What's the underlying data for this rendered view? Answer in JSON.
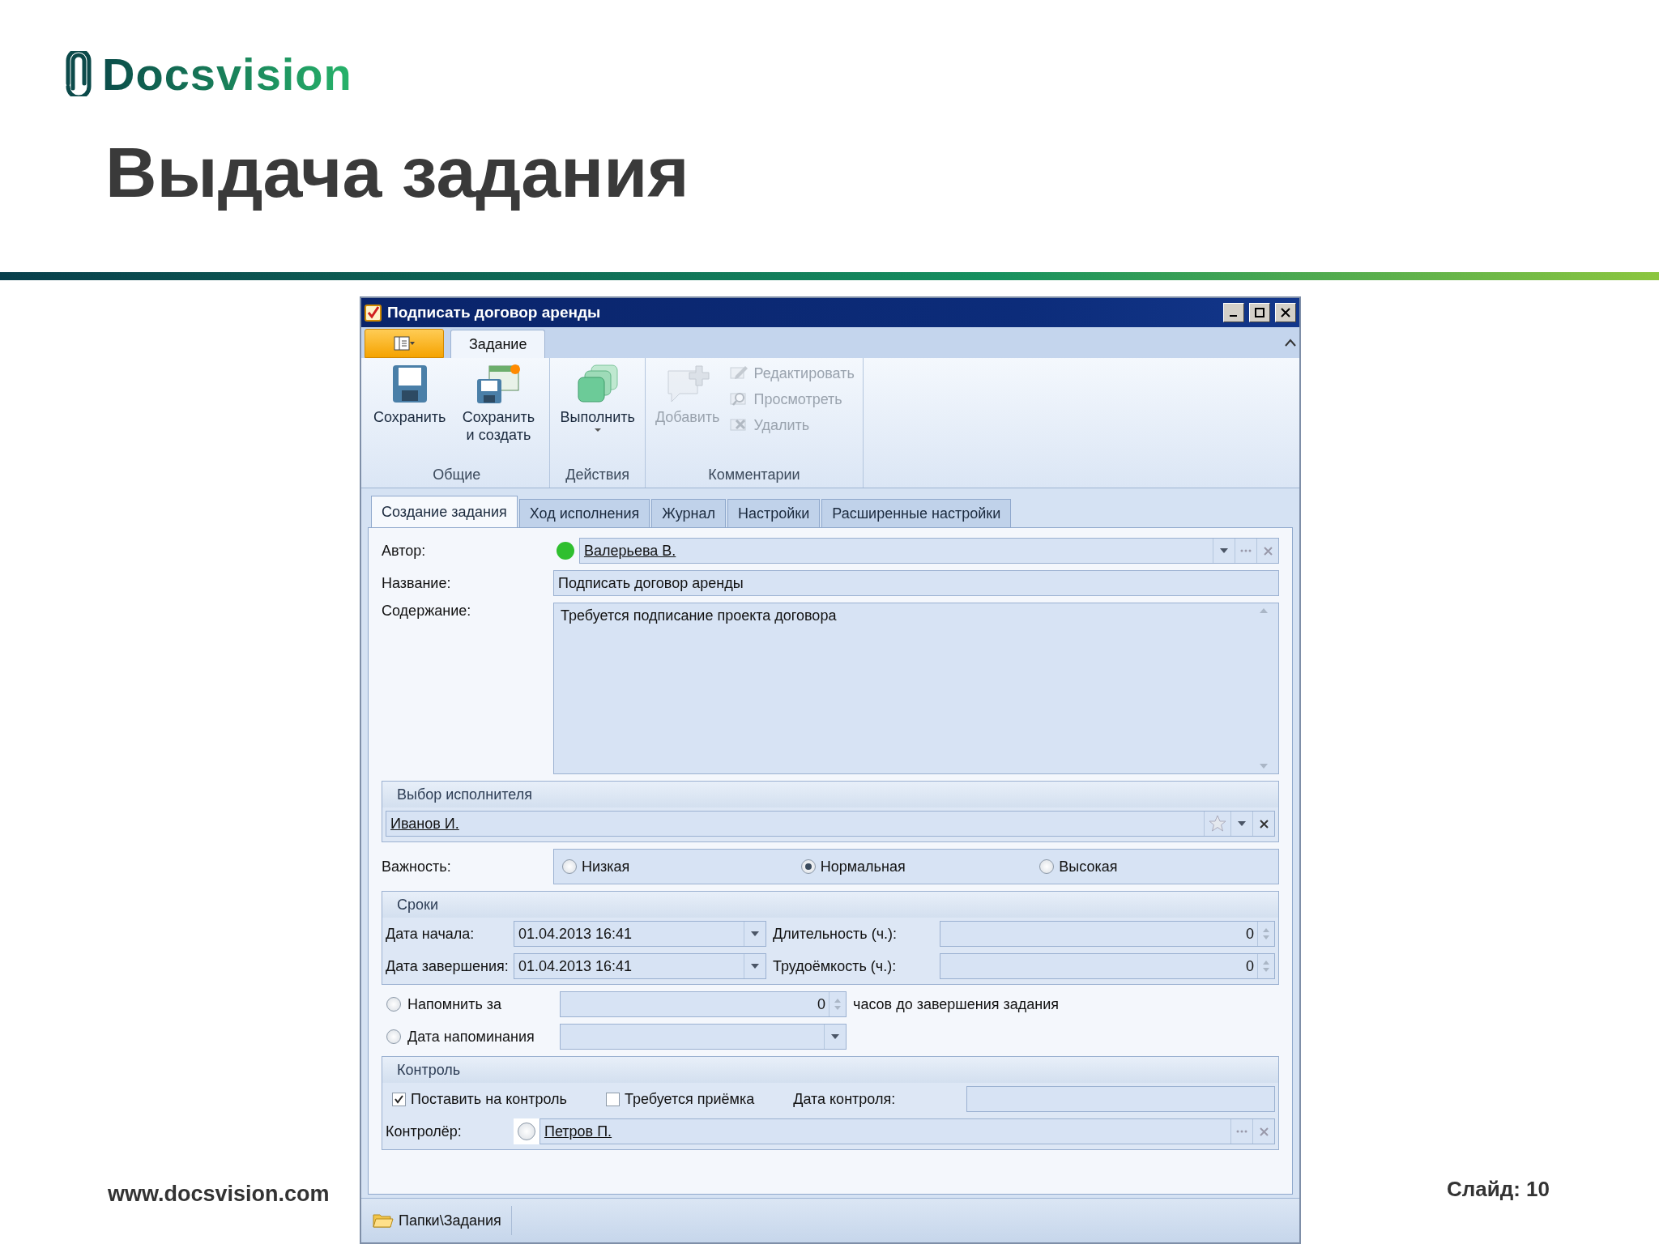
{
  "brand": {
    "logo_text": "Docsvision"
  },
  "slide_title": "Выдача задания",
  "window": {
    "title": "Подписать договор аренды",
    "ribbon": {
      "tabs": [
        {
          "label": "Задание",
          "selected": true
        }
      ],
      "groups": [
        {
          "label": "Общие",
          "buttons": [
            {
              "label": "Сохранить",
              "kind": "save",
              "disabled": false,
              "dropdown": false
            },
            {
              "label": "Сохранить и создать",
              "kind": "save-new",
              "disabled": false,
              "dropdown": false
            }
          ]
        },
        {
          "label": "Действия",
          "buttons": [
            {
              "label": "Выполнить",
              "kind": "run",
              "disabled": false,
              "dropdown": true
            }
          ]
        },
        {
          "label": "Комментарии",
          "buttons": [
            {
              "label": "Добавить",
              "kind": "add",
              "disabled": true,
              "dropdown": false
            }
          ],
          "small_buttons": [
            {
              "label": "Редактировать",
              "kind": "edit",
              "disabled": true
            },
            {
              "label": "Просмотреть",
              "kind": "view",
              "disabled": true
            },
            {
              "label": "Удалить",
              "kind": "delete",
              "disabled": true
            }
          ]
        }
      ]
    },
    "tabs": [
      {
        "label": "Создание задания",
        "selected": true
      },
      {
        "label": "Ход исполнения",
        "selected": false
      },
      {
        "label": "Журнал",
        "selected": false
      },
      {
        "label": "Настройки",
        "selected": false
      },
      {
        "label": "Расширенные настройки",
        "selected": false
      }
    ],
    "form": {
      "author": {
        "label": "Автор:",
        "value": "Валерьева В.",
        "color": "#2fbf2f"
      },
      "name": {
        "label": "Название:",
        "value": "Подписать договор аренды"
      },
      "content": {
        "label": "Содержание:",
        "value": "Требуется подписание проекта договора"
      },
      "performer": {
        "title": "Выбор исполнителя",
        "value": "Иванов И."
      },
      "importance": {
        "label": "Важность:",
        "options": [
          {
            "label": "Низкая",
            "selected": false
          },
          {
            "label": "Нормальная",
            "selected": true
          },
          {
            "label": "Высокая",
            "selected": false
          }
        ]
      },
      "deadlines": {
        "title": "Сроки",
        "rows": [
          {
            "label": "Дата начала:",
            "date": "01.04.2013 16:41",
            "amount_label": "Длительность (ч.):",
            "amount": "0"
          },
          {
            "label": "Дата завершения:",
            "date": "01.04.2013 16:41",
            "amount_label": "Трудоёмкость (ч.):",
            "amount": "0"
          }
        ]
      },
      "reminders": [
        {
          "kind": "spin",
          "label": "Напомнить за",
          "selected": false,
          "value": "0",
          "suffix": "часов до завершения задания"
        },
        {
          "kind": "date",
          "label": "Дата напоминания",
          "selected": false
        }
      ],
      "control": {
        "title": "Контроль",
        "checks": [
          {
            "label": "Поставить на контроль",
            "checked": true
          },
          {
            "label": "Требуется приёмка",
            "checked": false
          }
        ],
        "date_label": "Дата контроля:",
        "controller_label": "Контролёр:",
        "controller_value": "Петров П."
      }
    },
    "status_bar": {
      "path": "Папки\\Задания"
    }
  },
  "footer": {
    "url": "www.docsvision.com",
    "slide": "Слайд: 10"
  }
}
